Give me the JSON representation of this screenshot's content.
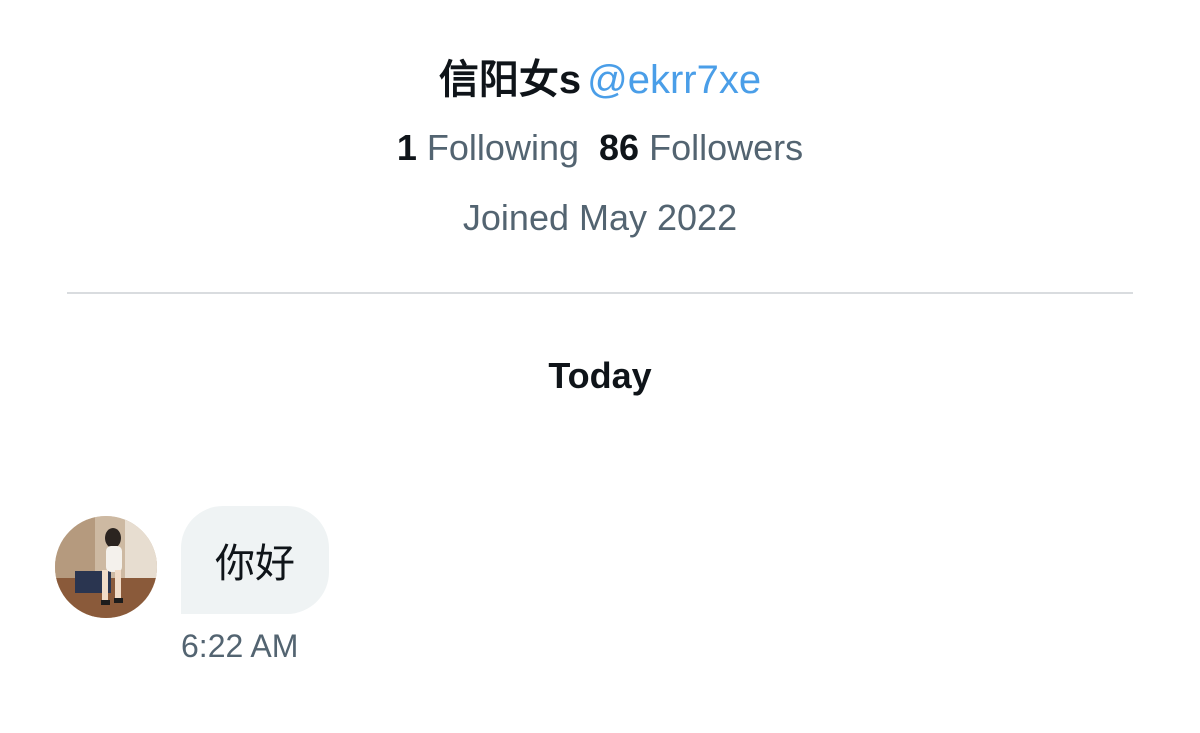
{
  "profile": {
    "display_name": "信阳女s",
    "handle": "@ekrr7xe",
    "following_count": "1",
    "following_label": "Following",
    "followers_count": "86",
    "followers_label": "Followers",
    "joined": "Joined May 2022"
  },
  "conversation": {
    "date_separator": "Today",
    "messages": [
      {
        "sender_avatar": "avatar-photo",
        "text": "你好",
        "time": "6:22 AM"
      }
    ]
  },
  "colors": {
    "handle": "#4a9ee8",
    "secondary_text": "#536471",
    "primary_text": "#0f1419",
    "bubble": "#eff3f4",
    "divider": "#d9dcdf"
  }
}
